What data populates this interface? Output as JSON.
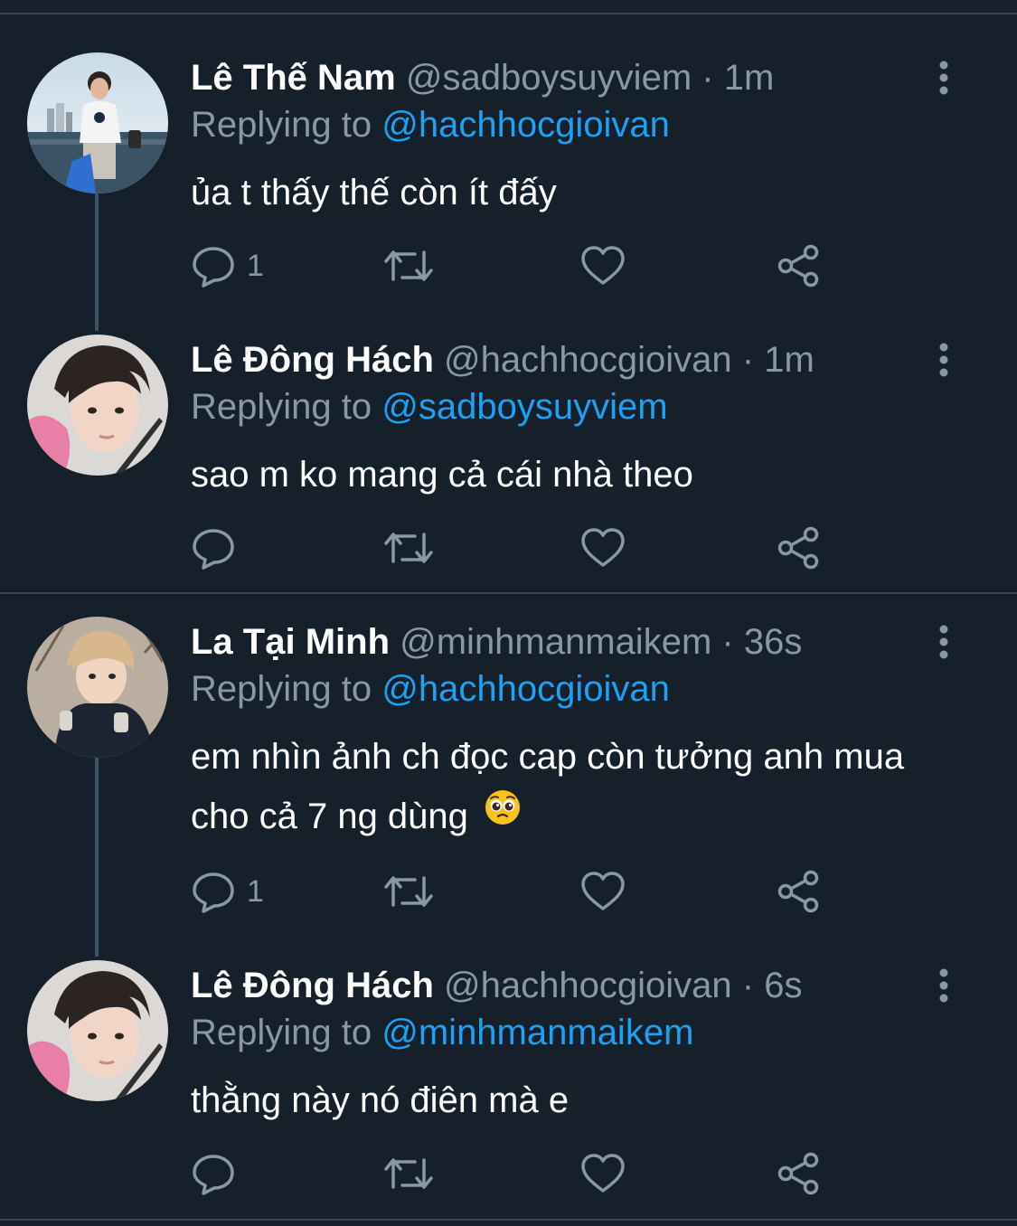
{
  "colors": {
    "background": "#15202b",
    "divider": "#38444d",
    "secondary_text": "#8899a6",
    "mention": "#1da1f2"
  },
  "tweets": [
    {
      "display_name": "Lê Thế Nam",
      "handle": "@sadboysuyviem",
      "separator": "·",
      "time": "1m",
      "replying_prefix": "Replying to",
      "replying_to": "@hachhocgioivan",
      "text": "ủa t thấy thế còn ít đấy",
      "reply_count": "1",
      "avatar_icon": "avatar-photo"
    },
    {
      "display_name": "Lê Đông Hách",
      "handle": "@hachhocgioivan",
      "separator": "·",
      "time": "1m",
      "replying_prefix": "Replying to",
      "replying_to": "@sadboysuyviem",
      "text": "sao m ko mang cả cái nhà theo",
      "reply_count": "",
      "avatar_icon": "avatar-photo"
    },
    {
      "display_name": "La Tại Minh",
      "handle": "@minhmanmaikem",
      "separator": "·",
      "time": "36s",
      "replying_prefix": "Replying to",
      "replying_to": "@hachhocgioivan",
      "text": "em nhìn ảnh ch đọc cap còn tưởng anh mua cho cả 7 ng dùng",
      "emoji": "pleading-face-emoji",
      "reply_count": "1",
      "avatar_icon": "avatar-photo"
    },
    {
      "display_name": "Lê Đông Hách",
      "handle": "@hachhocgioivan",
      "separator": "·",
      "time": "6s",
      "replying_prefix": "Replying to",
      "replying_to": "@minhmanmaikem",
      "text": "thằng này nó điên mà e",
      "reply_count": "",
      "avatar_icon": "avatar-photo"
    }
  ]
}
